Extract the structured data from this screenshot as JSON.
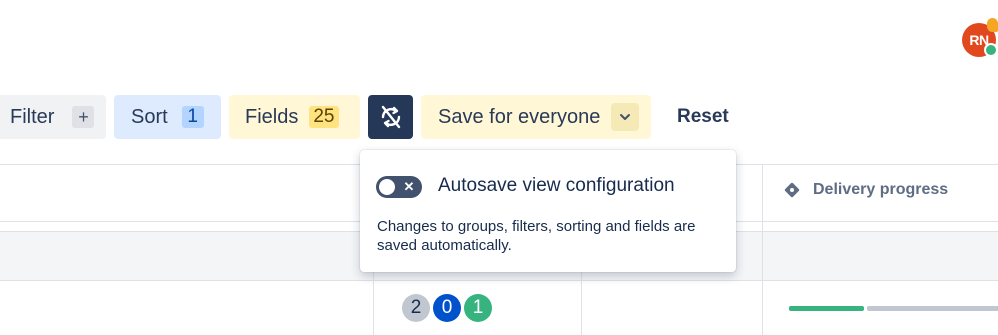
{
  "user": {
    "initials": "RN",
    "presence": "online"
  },
  "toolbar": {
    "filter_label": "Filter",
    "filter_add": "+",
    "sort_label": "Sort",
    "sort_count": "1",
    "fields_label": "Fields",
    "fields_count": "25",
    "autosave_icon": "sync-off-icon",
    "save_label": "Save for everyone",
    "reset_label": "Reset"
  },
  "popover": {
    "toggle_state": "off",
    "title": "Autosave view configuration",
    "description": "Changes to groups, filters, sorting and fields are saved automatically."
  },
  "table": {
    "columns": [
      {
        "label": "Delivery progress",
        "icon": "diamond-icon"
      }
    ],
    "rows": [
      {
        "badges": [
          "2",
          "0",
          "1"
        ],
        "delivery_progress": 0.35
      }
    ]
  },
  "colors": {
    "accent_dark": "#253858",
    "sort_bg": "#deebff",
    "fields_bg": "#fff7d6",
    "done_green": "#36b37e",
    "todo_gray": "#c1c7d0",
    "blue": "#0052cc"
  }
}
